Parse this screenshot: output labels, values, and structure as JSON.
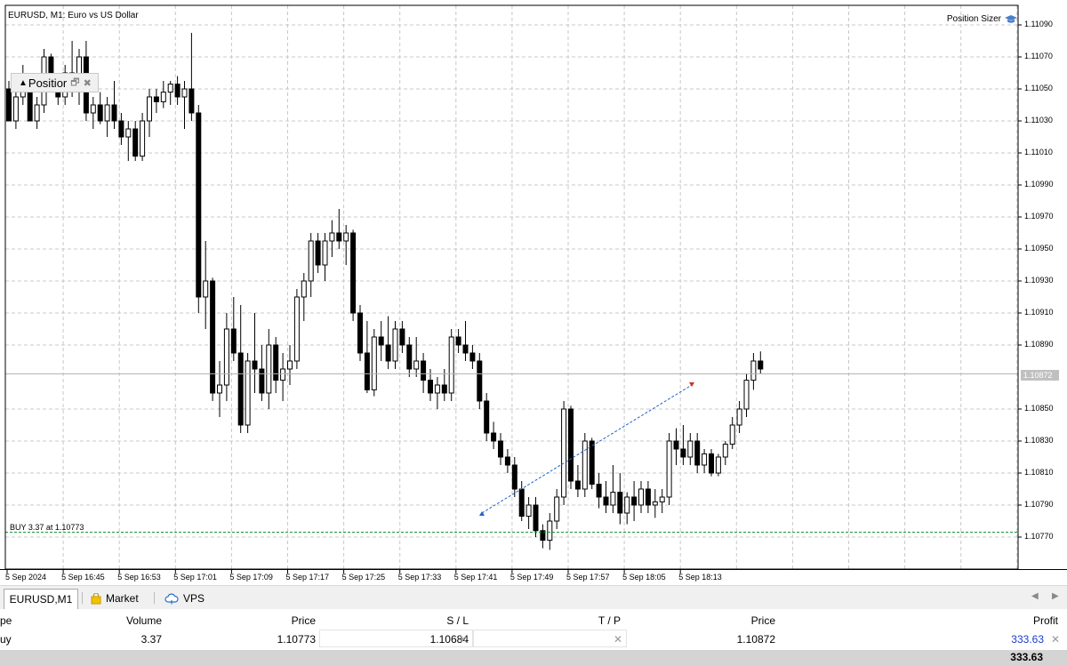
{
  "chart": {
    "title": "EURUSD, M1:  Euro vs US Dollar",
    "plugin_label": "Position Sizer",
    "panel_title": "Positior",
    "buy_line_label": "BUY 3.37 at 1.10773",
    "current_price": "1.10872",
    "price_ticks": [
      "1.11090",
      "1.11070",
      "1.11050",
      "1.11030",
      "1.11010",
      "1.10990",
      "1.10970",
      "1.10950",
      "1.10930",
      "1.10910",
      "1.10890",
      "1.10850",
      "1.10830",
      "1.10810",
      "1.10790",
      "1.10770"
    ],
    "time_ticks": [
      "5 Sep 2024",
      "5 Sep 16:45",
      "5 Sep 16:53",
      "5 Sep 17:01",
      "5 Sep 17:09",
      "5 Sep 17:17",
      "5 Sep 17:25",
      "5 Sep 17:33",
      "5 Sep 17:41",
      "5 Sep 17:49",
      "5 Sep 17:57",
      "5 Sep 18:05",
      "5 Sep 18:13"
    ],
    "icons": [
      "graduation-cap-icon",
      "restore-icon",
      "close-icon"
    ]
  },
  "tabs": {
    "active": "EURUSD,M1",
    "market": "Market",
    "vps": "VPS"
  },
  "table": {
    "headers": {
      "type": "pe",
      "volume": "Volume",
      "price": "Price",
      "sl": "S / L",
      "tp": "T / P",
      "cur_price": "Price",
      "profit": "Profit"
    },
    "row": {
      "type": "uy",
      "volume": "3.37",
      "price": "1.10773",
      "sl": "1.10684",
      "tp": "",
      "cur_price": "1.10872",
      "profit": "333.63"
    },
    "profit_color": "#1a3ccc",
    "total": "333.63"
  },
  "chart_data": {
    "type": "candlestick",
    "symbol": "EURUSD",
    "timeframe": "M1",
    "ylim": [
      1.1076,
      1.111
    ],
    "trade": {
      "side": "BUY",
      "volume": 3.37,
      "entry": 1.10773,
      "stop_loss": 1.10684,
      "current": 1.10872
    },
    "candles": [
      [
        1.1105,
        1.11055,
        1.11035,
        1.1103
      ],
      [
        1.1103,
        1.1106,
        1.11025,
        1.11045
      ],
      [
        1.11045,
        1.11065,
        1.1104,
        1.11055
      ],
      [
        1.11055,
        1.1106,
        1.11035,
        1.1103
      ],
      [
        1.1103,
        1.11045,
        1.11025,
        1.1104
      ],
      [
        1.1104,
        1.11075,
        1.11035,
        1.1107
      ],
      [
        1.1107,
        1.11072,
        1.1105,
        1.11055
      ],
      [
        1.11055,
        1.1106,
        1.1104,
        1.11045
      ],
      [
        1.11045,
        1.11065,
        1.1104,
        1.1106
      ],
      [
        1.1106,
        1.1108,
        1.11045,
        1.1105
      ],
      [
        1.1105,
        1.11075,
        1.1104,
        1.1107
      ],
      [
        1.1107,
        1.1108,
        1.1103,
        1.11035
      ],
      [
        1.11035,
        1.11045,
        1.11025,
        1.1104
      ],
      [
        1.1104,
        1.11048,
        1.11028,
        1.1103
      ],
      [
        1.1103,
        1.11045,
        1.1102,
        1.1104
      ],
      [
        1.1104,
        1.11055,
        1.11025,
        1.1103
      ],
      [
        1.1103,
        1.11035,
        1.11015,
        1.1102
      ],
      [
        1.1102,
        1.1103,
        1.11005,
        1.11025
      ],
      [
        1.11025,
        1.1103,
        1.11005,
        1.11008
      ],
      [
        1.11008,
        1.11035,
        1.11005,
        1.1103
      ],
      [
        1.1103,
        1.1105,
        1.1102,
        1.11045
      ],
      [
        1.11045,
        1.1105,
        1.11035,
        1.11042
      ],
      [
        1.11042,
        1.11055,
        1.11038,
        1.11048
      ],
      [
        1.11048,
        1.11055,
        1.1104,
        1.11053
      ],
      [
        1.11053,
        1.11058,
        1.1104,
        1.11045
      ],
      [
        1.11045,
        1.11055,
        1.11025,
        1.1105
      ],
      [
        1.1105,
        1.11085,
        1.1103,
        1.11035
      ],
      [
        1.11035,
        1.1104,
        1.1091,
        1.1092
      ],
      [
        1.1092,
        1.10955,
        1.109,
        1.1093
      ],
      [
        1.1093,
        1.10932,
        1.10855,
        1.1086
      ],
      [
        1.1086,
        1.1088,
        1.10845,
        1.10865
      ],
      [
        1.10865,
        1.1091,
        1.10855,
        1.109
      ],
      [
        1.109,
        1.1092,
        1.1088,
        1.10885
      ],
      [
        1.10885,
        1.10915,
        1.10835,
        1.1084
      ],
      [
        1.1084,
        1.10885,
        1.10835,
        1.1088
      ],
      [
        1.1088,
        1.1091,
        1.1086,
        1.10875
      ],
      [
        1.10875,
        1.1089,
        1.10855,
        1.1086
      ],
      [
        1.1086,
        1.109,
        1.1085,
        1.1089
      ],
      [
        1.1089,
        1.10895,
        1.1086,
        1.10868
      ],
      [
        1.10868,
        1.10885,
        1.10855,
        1.10875
      ],
      [
        1.10875,
        1.1089,
        1.10865,
        1.1088
      ],
      [
        1.1088,
        1.10925,
        1.10875,
        1.1092
      ],
      [
        1.1092,
        1.10935,
        1.10905,
        1.1093
      ],
      [
        1.1093,
        1.1096,
        1.1092,
        1.10955
      ],
      [
        1.10955,
        1.1096,
        1.10935,
        1.1094
      ],
      [
        1.1094,
        1.1096,
        1.1093,
        1.10955
      ],
      [
        1.10955,
        1.10968,
        1.10945,
        1.1096
      ],
      [
        1.1096,
        1.10975,
        1.1095,
        1.10955
      ],
      [
        1.10955,
        1.10965,
        1.1094,
        1.1096
      ],
      [
        1.1096,
        1.10962,
        1.10905,
        1.1091
      ],
      [
        1.1091,
        1.10915,
        1.1088,
        1.10885
      ],
      [
        1.10885,
        1.10905,
        1.1086,
        1.10862
      ],
      [
        1.10862,
        1.109,
        1.10858,
        1.10895
      ],
      [
        1.10895,
        1.10905,
        1.1088,
        1.1089
      ],
      [
        1.1089,
        1.10908,
        1.10875,
        1.1088
      ],
      [
        1.1088,
        1.10905,
        1.10875,
        1.109
      ],
      [
        1.109,
        1.10905,
        1.10885,
        1.1089
      ],
      [
        1.1089,
        1.10895,
        1.1087,
        1.10875
      ],
      [
        1.10875,
        1.10895,
        1.1087,
        1.1088
      ],
      [
        1.1088,
        1.10885,
        1.1086,
        1.10868
      ],
      [
        1.10868,
        1.10875,
        1.10855,
        1.1086
      ],
      [
        1.1086,
        1.1087,
        1.1085,
        1.10865
      ],
      [
        1.10865,
        1.10875,
        1.10855,
        1.1086
      ],
      [
        1.1086,
        1.109,
        1.10855,
        1.10895
      ],
      [
        1.10895,
        1.109,
        1.10885,
        1.1089
      ],
      [
        1.1089,
        1.10905,
        1.1088,
        1.10885
      ],
      [
        1.10885,
        1.1089,
        1.10875,
        1.1088
      ],
      [
        1.1088,
        1.10885,
        1.1085,
        1.10855
      ],
      [
        1.10855,
        1.1086,
        1.1083,
        1.10835
      ],
      [
        1.10835,
        1.10842,
        1.10825,
        1.1083
      ],
      [
        1.1083,
        1.10835,
        1.10815,
        1.1082
      ],
      [
        1.1082,
        1.10825,
        1.1081,
        1.10815
      ],
      [
        1.10815,
        1.1082,
        1.10795,
        1.108
      ],
      [
        1.108,
        1.10805,
        1.1078,
        1.10783
      ],
      [
        1.10783,
        1.10795,
        1.10775,
        1.1079
      ],
      [
        1.1079,
        1.10795,
        1.1077,
        1.10774
      ],
      [
        1.10774,
        1.10778,
        1.10763,
        1.10768
      ],
      [
        1.10768,
        1.10785,
        1.10762,
        1.1078
      ],
      [
        1.1078,
        1.108,
        1.10775,
        1.10795
      ],
      [
        1.10795,
        1.10855,
        1.1079,
        1.1085
      ],
      [
        1.1085,
        1.10852,
        1.108,
        1.10805
      ],
      [
        1.10805,
        1.10815,
        1.10795,
        1.108
      ],
      [
        1.108,
        1.10835,
        1.10795,
        1.1083
      ],
      [
        1.1083,
        1.10832,
        1.108,
        1.10803
      ],
      [
        1.10803,
        1.1081,
        1.10788,
        1.10795
      ],
      [
        1.10795,
        1.10805,
        1.10785,
        1.1079
      ],
      [
        1.1079,
        1.10815,
        1.10785,
        1.10798
      ],
      [
        1.10798,
        1.1081,
        1.10778,
        1.10785
      ],
      [
        1.10785,
        1.10798,
        1.10778,
        1.10795
      ],
      [
        1.10795,
        1.10805,
        1.1078,
        1.1079
      ],
      [
        1.1079,
        1.10805,
        1.10785,
        1.108
      ],
      [
        1.108,
        1.10805,
        1.10785,
        1.1079
      ],
      [
        1.1079,
        1.108,
        1.10782,
        1.10792
      ],
      [
        1.10792,
        1.108,
        1.10785,
        1.10795
      ],
      [
        1.10795,
        1.10835,
        1.1079,
        1.1083
      ],
      [
        1.1083,
        1.10838,
        1.10815,
        1.10825
      ],
      [
        1.10825,
        1.1084,
        1.10815,
        1.1082
      ],
      [
        1.1082,
        1.10835,
        1.10815,
        1.1083
      ],
      [
        1.1083,
        1.10835,
        1.1081,
        1.10815
      ],
      [
        1.10815,
        1.10825,
        1.1081,
        1.10822
      ],
      [
        1.10822,
        1.10825,
        1.10808,
        1.1081
      ],
      [
        1.1081,
        1.10822,
        1.10808,
        1.1082
      ],
      [
        1.1082,
        1.1083,
        1.10815,
        1.10828
      ],
      [
        1.10828,
        1.10845,
        1.10825,
        1.1084
      ],
      [
        1.1084,
        1.10855,
        1.10835,
        1.1085
      ],
      [
        1.1085,
        1.10872,
        1.10845,
        1.10868
      ],
      [
        1.10868,
        1.10885,
        1.10862,
        1.1088
      ],
      [
        1.1088,
        1.10886,
        1.10872,
        1.10875
      ]
    ]
  }
}
